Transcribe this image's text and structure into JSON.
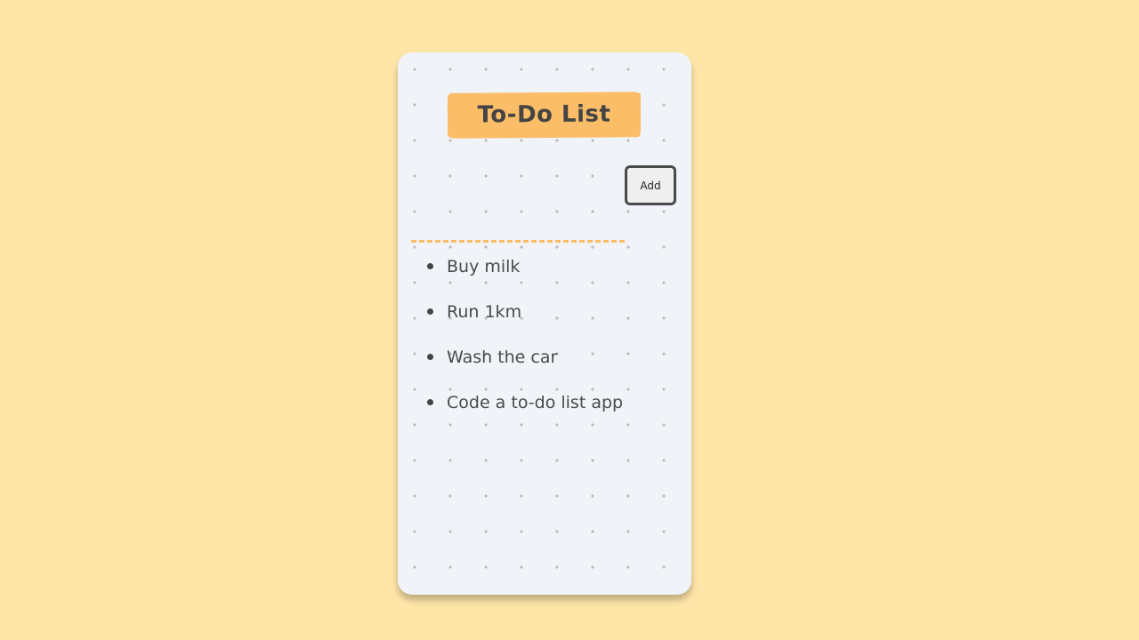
{
  "app": {
    "title": "To-Do List",
    "add_label": "Add",
    "input_value": "",
    "input_placeholder": ""
  },
  "tasks": [
    {
      "label": "Buy milk"
    },
    {
      "label": "Run 1km"
    },
    {
      "label": "Wash the car"
    },
    {
      "label": "Code a to-do list app"
    }
  ],
  "colors": {
    "page_background": "#ffe6a8",
    "card_background": "#f0f4f9",
    "accent": "#fbbd68",
    "text": "#4a4a4a",
    "dot_grid": "#bcbcbc"
  }
}
